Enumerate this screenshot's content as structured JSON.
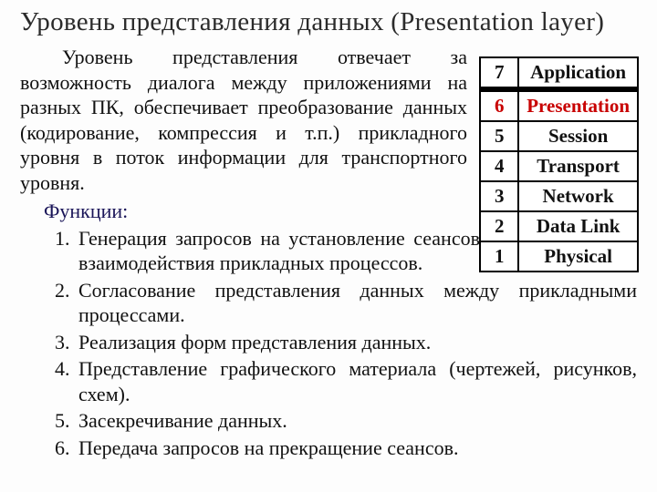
{
  "title": "Уровень представления данных (Presentation layer)",
  "intro": "Уровень представления отвечает за возможность диалога между приложениями на разных ПК, обеспечивает преобразование данных (кодирование, компрессия и т.п.) прикладного уровня в поток информации для транспортного уровня.",
  "functions_label": "Функции:",
  "functions": {
    "f1": "Генерация запросов на установление сеансов взаимодействия прикладных процессов.",
    "f2": "Согласование представления данных между прикладными процессами.",
    "f3": "Реализация форм представления данных.",
    "f4": "Представление графического материала (чертежей, рисунков, схем).",
    "f5": "Засекречивание данных.",
    "f6": "Передача запросов на прекращение сеансов."
  },
  "osi": {
    "r7": {
      "n": "7",
      "name": "Application"
    },
    "r6": {
      "n": "6",
      "name": "Presentation"
    },
    "r5": {
      "n": "5",
      "name": "Session"
    },
    "r4": {
      "n": "4",
      "name": "Transport"
    },
    "r3": {
      "n": "3",
      "name": "Network"
    },
    "r2": {
      "n": "2",
      "name": "Data Link"
    },
    "r1": {
      "n": "1",
      "name": "Physical"
    }
  }
}
